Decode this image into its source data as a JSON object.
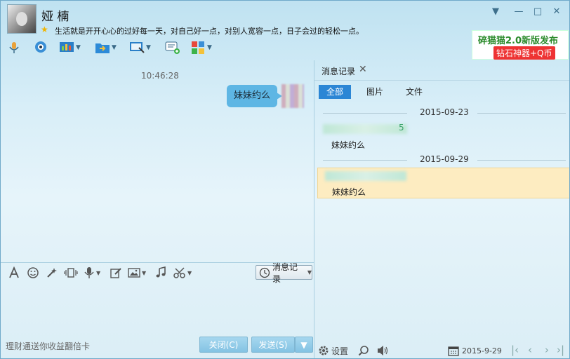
{
  "contact": {
    "name": "娅 楠",
    "signature": "生活就是开开心心的过好每一天，对自己好一点，对别人宽容一点，日子会过的轻松一点。"
  },
  "window_controls": {
    "dropdown": "▼",
    "minimize": "—",
    "maximize": "□",
    "close": "✕"
  },
  "toolbar": {
    "icons": [
      "microphone-icon",
      "camera-icon",
      "screen-share-icon",
      "file-transfer-icon",
      "remote-desktop-icon",
      "message-add-icon",
      "apps-icon"
    ]
  },
  "ad": {
    "line1": "碎猫猫2.0新版发布",
    "line2": "钻石神器+Q币"
  },
  "chat": {
    "time": "10:46:28",
    "message": "妹妹约么"
  },
  "input_toolbar": {
    "history_label": "消息记录"
  },
  "footer": {
    "promo": "理财通送你收益翻倍卡",
    "close_label": "关闭(C)",
    "send_label": "发送(S)"
  },
  "history_panel": {
    "tab_label": "消息记录",
    "filters": [
      "全部",
      "图片",
      "文件"
    ],
    "groups": [
      {
        "date": "2015-09-23",
        "sender_tail": "5",
        "text": "妹妹约么"
      },
      {
        "date": "2015-09-29",
        "text": "妹妹约么"
      }
    ],
    "settings_label": "设置",
    "date_value": "2015-9-29"
  },
  "colors": {
    "accent": "#2b86d5",
    "bubble": "#5eb6e4",
    "highlight": "#fdecc1"
  }
}
